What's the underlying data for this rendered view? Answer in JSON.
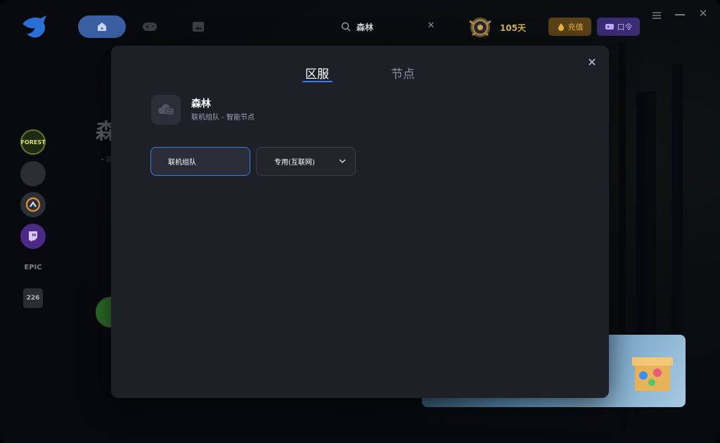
{
  "topbar": {
    "search_value": "森林",
    "vip_days": "105天",
    "recharge_label": "充值",
    "code_label": "口令"
  },
  "sidebar": {
    "items": [
      {
        "name": "forest",
        "text": "FOREST"
      },
      {
        "name": "blank",
        "text": ""
      },
      {
        "name": "overwatch",
        "text": ""
      },
      {
        "name": "twitch",
        "text": ""
      },
      {
        "name": "epic",
        "text": "EPIC"
      },
      {
        "name": "more",
        "text": "226"
      }
    ]
  },
  "background": {
    "title_glyph": "森",
    "dot_text": "• 同"
  },
  "dialog": {
    "tabs": [
      {
        "label": "区服",
        "active": true
      },
      {
        "label": "节点",
        "active": false
      }
    ],
    "game": {
      "name": "森林",
      "subtitle": "联机组队 - 智能节点"
    },
    "mode_button": "联机组队",
    "line_select": {
      "selected": "专用(互联网)"
    }
  },
  "colors": {
    "accent": "#3c7be6",
    "dialog_bg": "#1e2028",
    "gold": "#d6b455",
    "recharge_bg": "#5a4118",
    "code_bg": "#3a2c70"
  }
}
